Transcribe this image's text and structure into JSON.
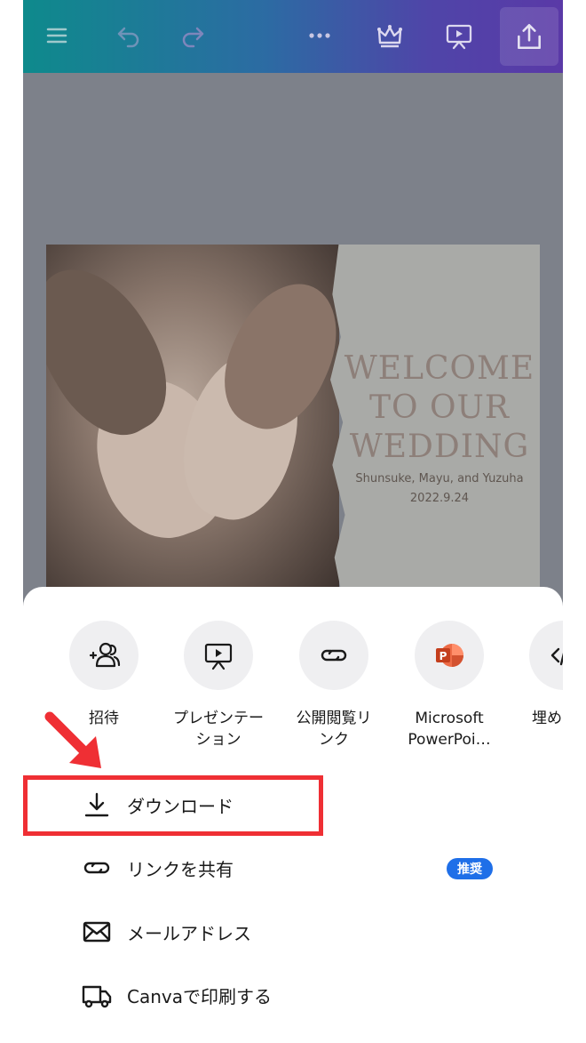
{
  "toolbar": {
    "icons": [
      "menu-icon",
      "undo-icon",
      "redo-icon",
      "more-icon",
      "crown-icon",
      "present-icon",
      "share-icon"
    ]
  },
  "design": {
    "title": "WELCOME TO OUR WEDDING",
    "names": "Shunsuke, Mayu, and Yuzuha",
    "date": "2022.9.24"
  },
  "share_sheet": {
    "options": [
      {
        "label": "招待",
        "icon": "invite-people-icon"
      },
      {
        "label": "プレゼンテーション",
        "icon": "presentation-icon"
      },
      {
        "label": "公開閲覧リンク",
        "icon": "link-icon"
      },
      {
        "label": "Microsoft PowerPoi…",
        "icon": "powerpoint-icon"
      },
      {
        "label": "埋め",
        "icon": "embed-code-icon"
      }
    ],
    "actions": [
      {
        "label": "ダウンロード",
        "icon": "download-icon"
      },
      {
        "label": "リンクを共有",
        "icon": "link-icon",
        "badge": "推奨"
      },
      {
        "label": "メールアドレス",
        "icon": "mail-icon"
      },
      {
        "label": "Canvaで印刷する",
        "icon": "truck-icon"
      }
    ]
  },
  "colors": {
    "accent_badge": "#1f6fe8",
    "highlight": "#ef2f34",
    "powerpoint": "#d24726"
  }
}
